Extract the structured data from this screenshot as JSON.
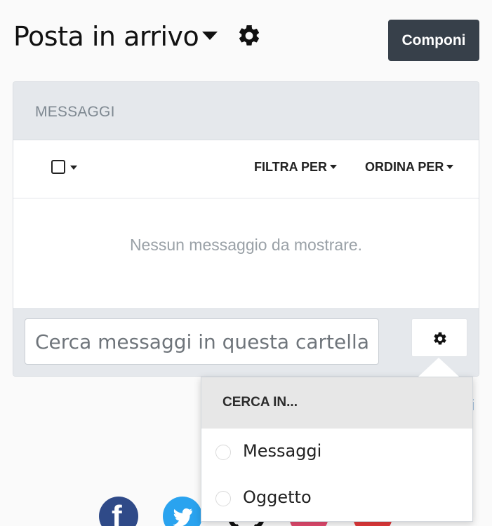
{
  "header": {
    "title": "Posta in arrivo",
    "compose_label": "Componi"
  },
  "panel": {
    "heading": "MESSAGGI",
    "filter_label": "FILTRA PER",
    "order_label": "ORDINA PER",
    "empty_message": "Nessun messaggio da mostrare.",
    "search_placeholder": "Cerca messaggi in questa cartella..."
  },
  "background_link_fragment": "i",
  "search_dropdown": {
    "heading": "CERCA IN...",
    "options": [
      {
        "label": "Messaggi",
        "selected": false
      },
      {
        "label": "Oggetto",
        "selected": false
      }
    ]
  },
  "social": {
    "icons": [
      "facebook-icon",
      "twitter-icon",
      "github-icon",
      "instagram-icon",
      "youtube-icon"
    ]
  },
  "colors": {
    "compose_bg": "#37404a",
    "panel_head_bg": "#e5e8ec",
    "facebook": "#2f4a88",
    "twitter": "#2aa3ef",
    "instagram": "#e24a6e",
    "youtube": "#e2393b"
  }
}
